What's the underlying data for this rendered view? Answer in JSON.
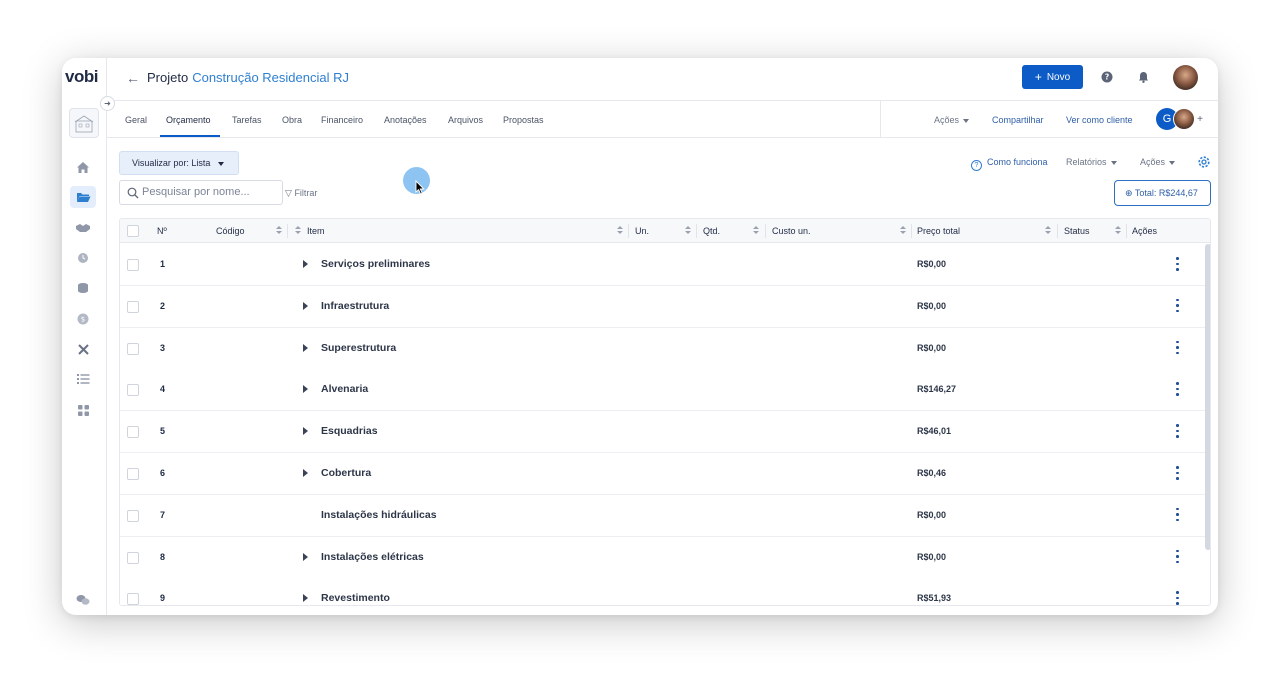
{
  "app": {
    "logo": "vobi"
  },
  "header": {
    "title_prefix": "Projeto",
    "project_name": "Construção Residencial RJ",
    "new_button": "Novo",
    "plus": "+"
  },
  "tabs": [
    {
      "label": "Geral"
    },
    {
      "label": "Orçamento"
    },
    {
      "label": "Tarefas"
    },
    {
      "label": "Obra"
    },
    {
      "label": "Financeiro"
    },
    {
      "label": "Anotações"
    },
    {
      "label": "Arquivos"
    },
    {
      "label": "Propostas"
    }
  ],
  "tab_actions": {
    "acoes": "Ações",
    "share": "Compartilhar",
    "client_view": "Ver como cliente",
    "avatar_initial": "G",
    "add": "+"
  },
  "toolbar": {
    "view_label": "Visualizar por: Lista",
    "search_placeholder": "Pesquisar por nome...",
    "filter": "Filtrar",
    "how_it_works": "Como funciona",
    "reports": "Relatórios",
    "actions": "Ações",
    "total": "Total: R$244,67"
  },
  "table": {
    "headers": {
      "num": "Nº",
      "code": "Código",
      "item": "Item",
      "unit": "Un.",
      "qty": "Qtd.",
      "unit_cost": "Custo un.",
      "total_price": "Preço total",
      "status": "Status",
      "actions": "Ações"
    },
    "rows": [
      {
        "num": "1",
        "name": "Serviços preliminares",
        "price": "R$0,00",
        "expandable": true
      },
      {
        "num": "2",
        "name": "Infraestrutura",
        "price": "R$0,00",
        "expandable": true
      },
      {
        "num": "3",
        "name": "Superestrutura",
        "price": "R$0,00",
        "expandable": true
      },
      {
        "num": "4",
        "name": "Alvenaria",
        "price": "R$146,27",
        "expandable": true
      },
      {
        "num": "5",
        "name": "Esquadrias",
        "price": "R$46,01",
        "expandable": true
      },
      {
        "num": "6",
        "name": "Cobertura",
        "price": "R$0,46",
        "expandable": true
      },
      {
        "num": "7",
        "name": "Instalações hidráulicas",
        "price": "R$0,00",
        "expandable": false
      },
      {
        "num": "8",
        "name": "Instalações elétricas",
        "price": "R$0,00",
        "expandable": true
      },
      {
        "num": "9",
        "name": "Revestimento",
        "price": "R$51,93",
        "expandable": true
      }
    ]
  },
  "colors": {
    "accent": "#0c5bc7",
    "link": "#2f7fd1",
    "text": "#1f2a44"
  }
}
